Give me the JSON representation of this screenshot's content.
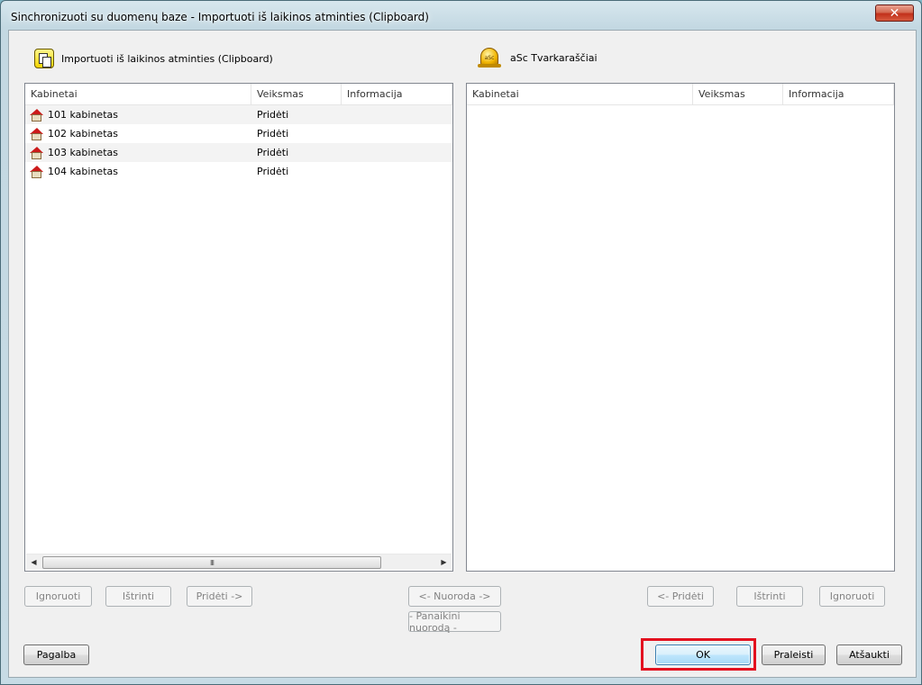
{
  "window": {
    "title": "Sinchronizuoti su duomenų baze - Importuoti iš laikinos atminties (Clipboard)",
    "close_label": "✕"
  },
  "left": {
    "header_label": "Importuoti iš laikinos atminties (Clipboard)",
    "icon": "clipboard-icon",
    "columns": [
      "Kabinetai",
      "Veiksmas",
      "Informacija"
    ],
    "rows": [
      {
        "name": "101 kabinetas",
        "action": "Pridėti",
        "info": ""
      },
      {
        "name": "102 kabinetas",
        "action": "Pridėti",
        "info": ""
      },
      {
        "name": "103 kabinetas",
        "action": "Pridėti",
        "info": ""
      },
      {
        "name": "104 kabinetas",
        "action": "Pridėti",
        "info": ""
      }
    ],
    "scroll_thumb_grip": "III"
  },
  "right": {
    "header_label": "aSc Tvarkaraščiai",
    "icon": "asc-bell-icon",
    "icon_text": "aSc",
    "columns": [
      "Kabinetai",
      "Veiksmas",
      "Informacija"
    ],
    "rows": []
  },
  "actions": {
    "ignore_left": "Ignoruoti",
    "delete_left": "Ištrinti",
    "add_right": "Pridėti ->",
    "link": "<- Nuoroda ->",
    "unlink": "- Panaikini nuorodą -",
    "add_left": "<- Pridėti",
    "delete_right": "Ištrinti",
    "ignore_right": "Ignoruoti"
  },
  "footer": {
    "help": "Pagalba",
    "ok": "OK",
    "skip": "Praleisti",
    "cancel": "Atšaukti"
  },
  "colors": {
    "highlight": "#e3101f",
    "titlebar": "#c3d8e2",
    "close": "#c2301a"
  }
}
